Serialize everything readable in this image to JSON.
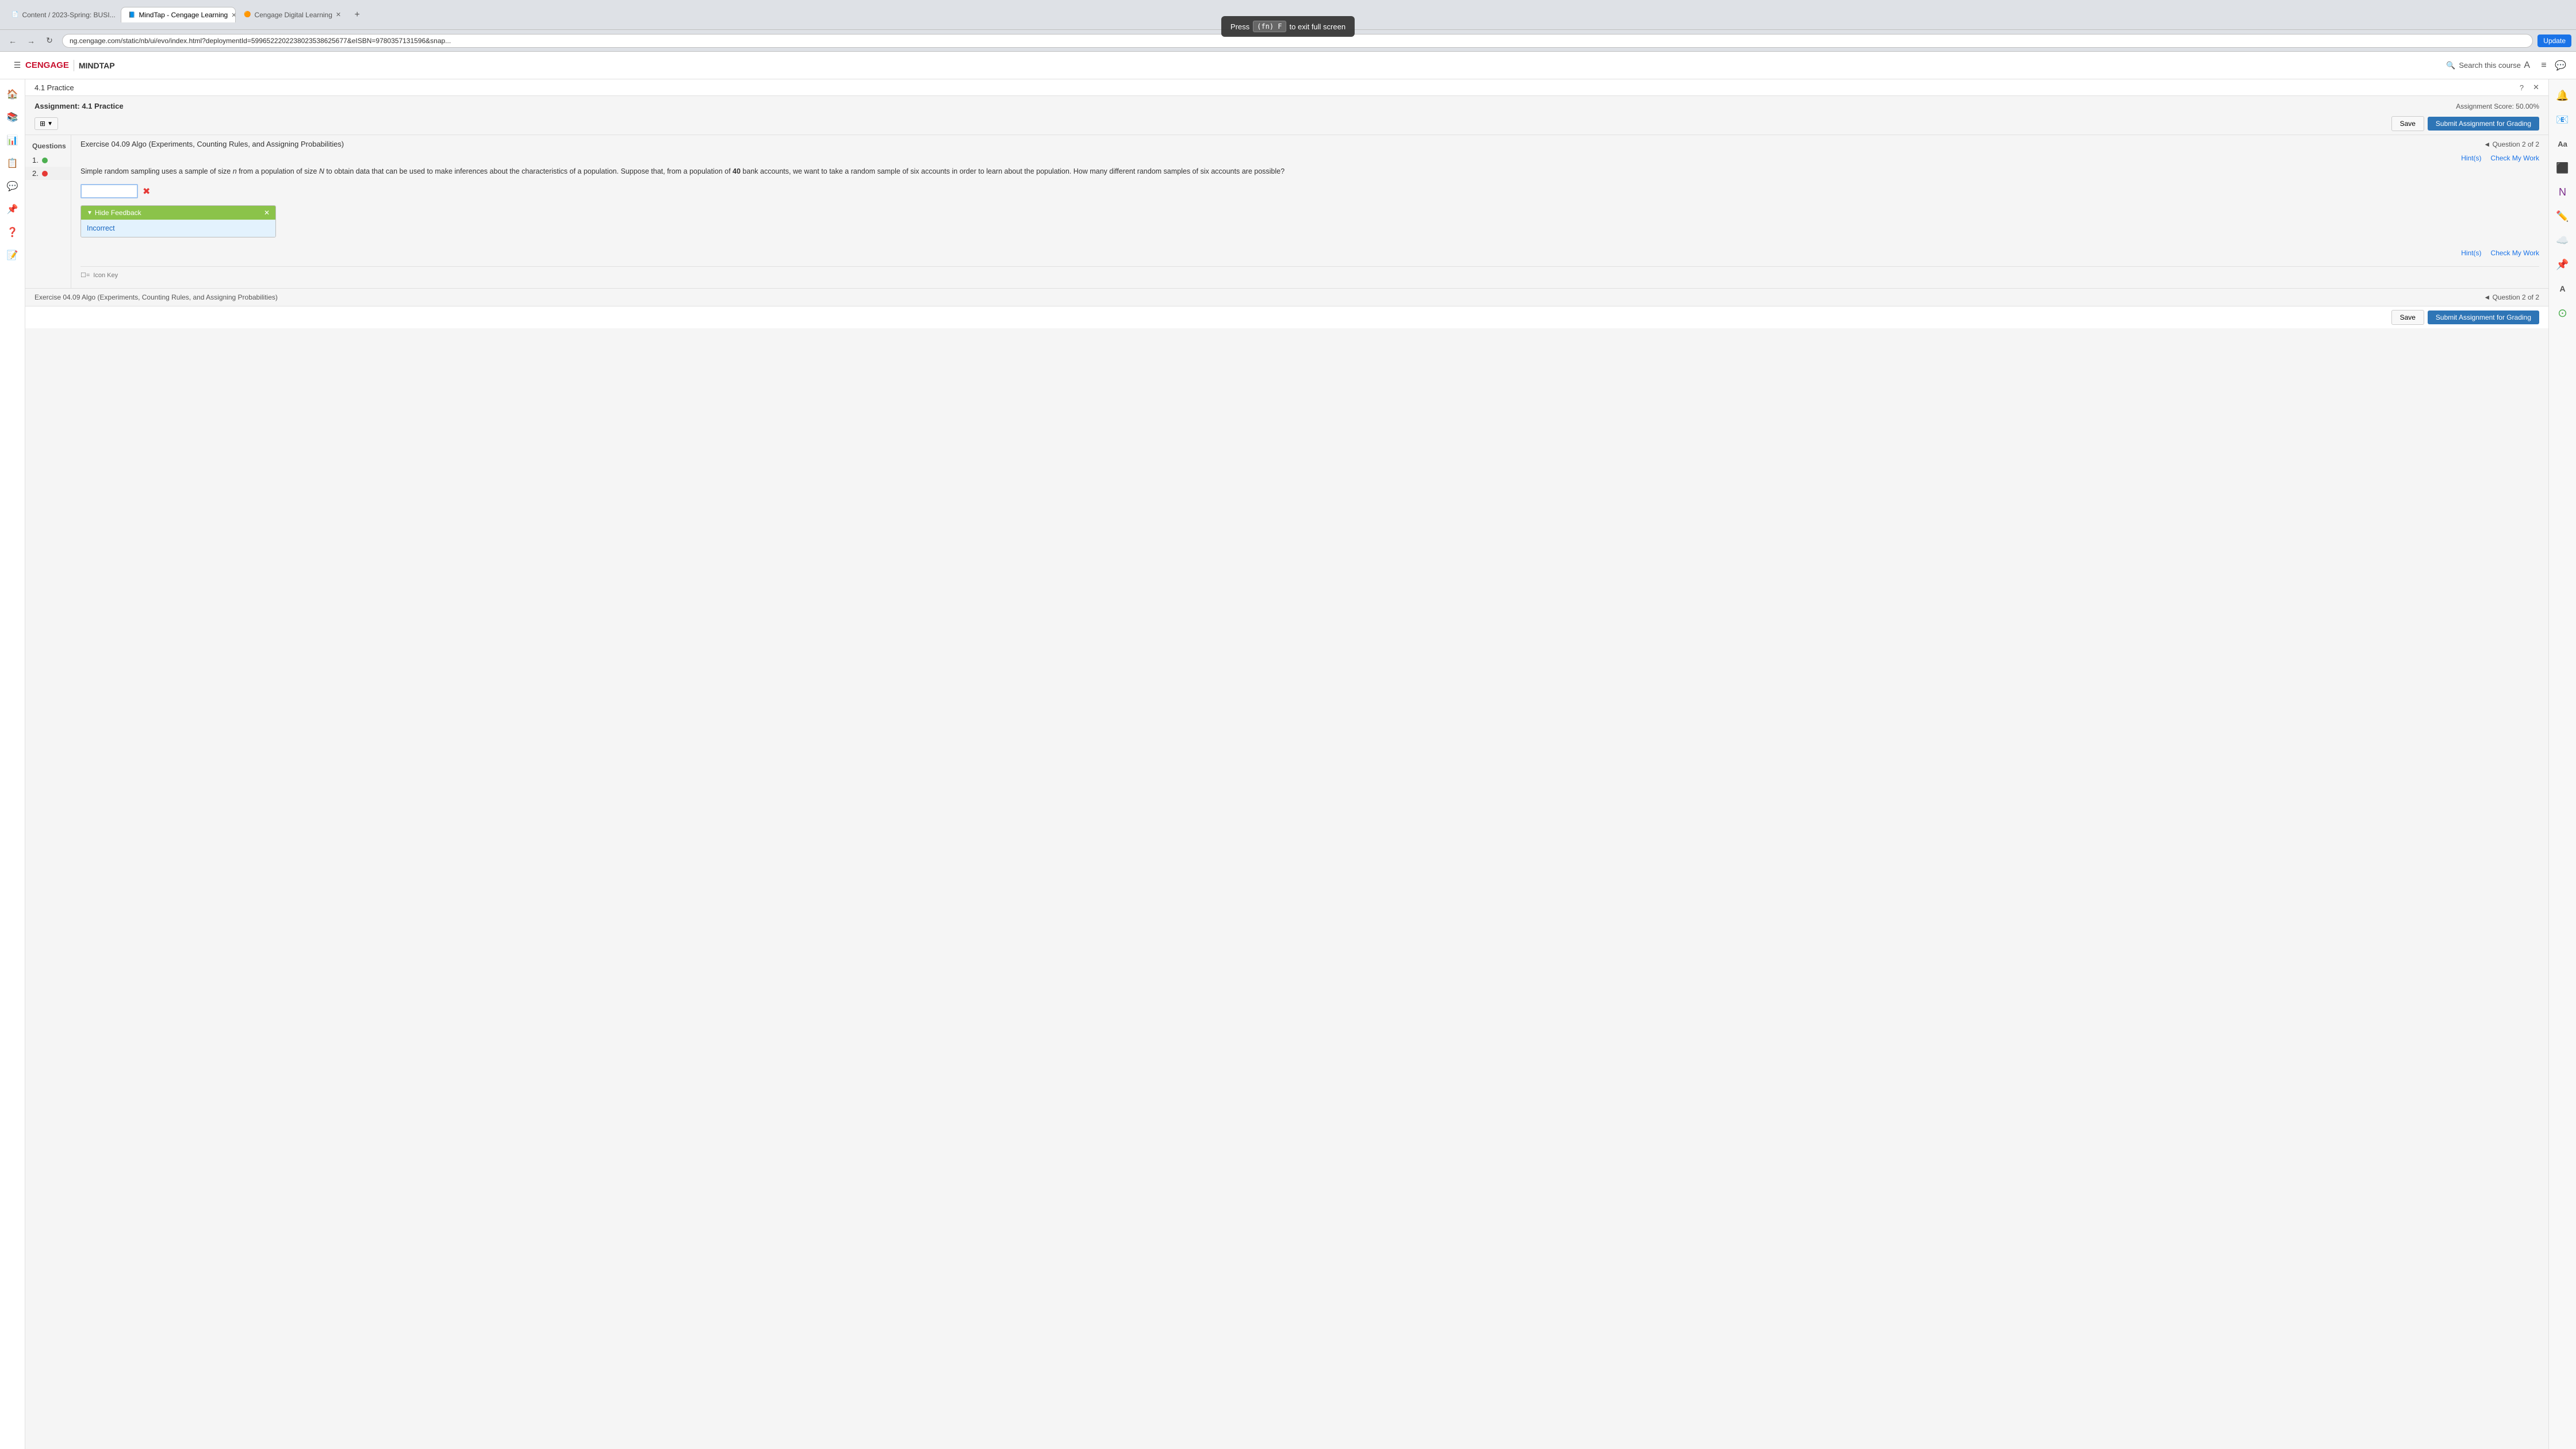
{
  "browser": {
    "tabs": [
      {
        "label": "Content / 2023-Spring: BUSI...",
        "active": false,
        "favicon": "📄"
      },
      {
        "label": "MindTap - Cengage Learning",
        "active": true,
        "favicon": "📘"
      },
      {
        "label": "Cengage Digital Learning",
        "active": false,
        "favicon": "🟠"
      }
    ],
    "address": "ng.cengage.com/static/nb/ui/evo/index.html?deploymentId=5996522202238023538625677&eISBN=9780357131596&snap...",
    "add_tab_label": "+",
    "nav_back": "←",
    "nav_forward": "→",
    "nav_reload": "↻",
    "update_btn": "Update"
  },
  "keyboard_tooltip": {
    "text_before": "Press",
    "key": "(fn) F",
    "text_after": "to exit full screen"
  },
  "cengage": {
    "logo_text": "CENGAGE",
    "separator": "|",
    "mindtap_label": "MINDTAP",
    "search_label": "Search this course",
    "page_title": "4.1 Practice",
    "help_icon": "?",
    "close_icon": "✕"
  },
  "right_sidebar": {
    "icons": [
      "🏠",
      "📋",
      "📊",
      "📧",
      "📝",
      "🔧",
      "🔔",
      "☁️",
      "📌",
      "🅰️",
      "⭕"
    ]
  },
  "left_sidebar": {
    "icons": [
      "☰",
      "🏠",
      "📚",
      "📊",
      "📋",
      "💬",
      "📌",
      "❓",
      "📝"
    ]
  },
  "assignment": {
    "title": "Assignment: 4.1 Practice",
    "score_label": "Assignment Score: 50.00%",
    "save_btn": "Save",
    "submit_btn": "Submit Assignment for Grading",
    "save_btn_bottom": "Save",
    "submit_btn_bottom": "Submit Assignment for Grading"
  },
  "questions": {
    "header": "Questions",
    "items": [
      {
        "num": "1.",
        "status": "green"
      },
      {
        "num": "2.",
        "status": "red"
      }
    ]
  },
  "exercise": {
    "title": "Exercise 04.09 Algo (Experiments, Counting Rules, and Assigning Probabilities)",
    "question_nav": "◄ Question 2 of 2",
    "question_nav_bottom": "◄ Question 2 of 2",
    "question_text": "Simple random sampling uses a sample of size n from a population of size N to obtain data that can be used to make inferences about the characteristics of a population. Suppose that, from a population of 40 bank accounts, we want to take a random sample of six accounts in order to learn about the population. How many different random samples of six accounts are possible?",
    "bold_num": "40",
    "answer_placeholder": "",
    "hint_label": "Hint(s)",
    "check_label_top": "Check My Work",
    "check_label_bottom": "Check My Work",
    "feedback": {
      "header": "Hide Feedback",
      "arrow": "▼",
      "close": "✕",
      "body": "Incorrect"
    },
    "icon_key": "Icon Key",
    "icon_key_symbol": "☐=",
    "footer_title": "Exercise 04.09 Algo (Experiments, Counting Rules, and Assigning Probabilities)",
    "footer_nav": "◄ Question 2 of 2"
  }
}
